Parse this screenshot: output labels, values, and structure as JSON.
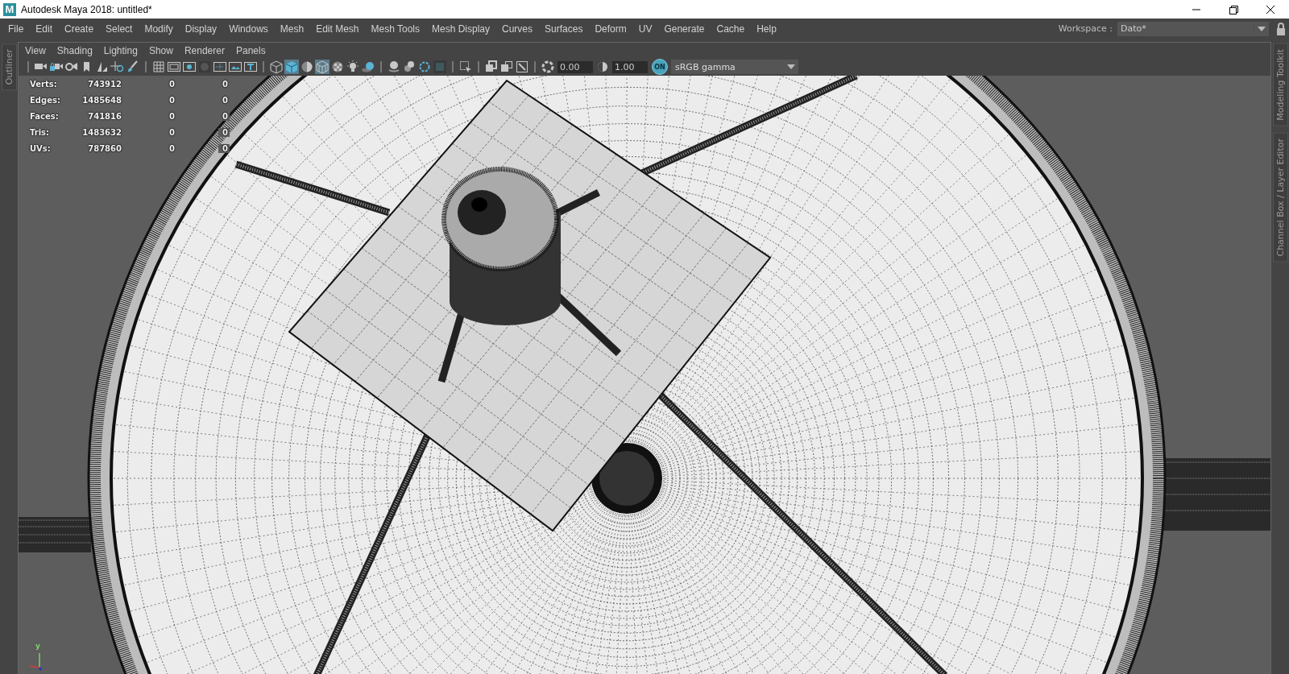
{
  "window": {
    "app_logo": "M",
    "title": "Autodesk Maya 2018: untitled*"
  },
  "menubar": [
    "File",
    "Edit",
    "Create",
    "Select",
    "Modify",
    "Display",
    "Windows",
    "Mesh",
    "Edit Mesh",
    "Mesh Tools",
    "Mesh Display",
    "Curves",
    "Surfaces",
    "Deform",
    "UV",
    "Generate",
    "Cache",
    "Help"
  ],
  "workspace": {
    "label": "Workspace :",
    "value": "Dato*",
    "locked": true
  },
  "left_tabs": [
    "Outliner"
  ],
  "right_tabs": [
    "Modeling Toolkit",
    "Channel Box / Layer Editor"
  ],
  "panel_menu": [
    "View",
    "Shading",
    "Lighting",
    "Show",
    "Renderer",
    "Panels"
  ],
  "toolbar": [
    {
      "kind": "separator"
    },
    {
      "kind": "icon",
      "selected": false
    },
    {
      "kind": "icon",
      "selected": false
    },
    {
      "kind": "icon",
      "selected": false
    },
    {
      "kind": "icon",
      "selected": false
    },
    {
      "kind": "icon",
      "selected": false
    },
    {
      "kind": "icon",
      "selected": false
    },
    {
      "kind": "icon",
      "selected": false
    },
    {
      "kind": "separator"
    },
    {
      "kind": "icon",
      "selected": false
    },
    {
      "kind": "icon",
      "selected": false
    },
    {
      "kind": "icon",
      "selected": false
    },
    {
      "kind": "icon",
      "selected": false
    },
    {
      "kind": "icon",
      "selected": false
    },
    {
      "kind": "icon",
      "selected": false
    },
    {
      "kind": "icon",
      "selected": false
    },
    {
      "kind": "separator"
    },
    {
      "kind": "icon",
      "selected": false
    },
    {
      "kind": "icon",
      "selected": true
    },
    {
      "kind": "icon",
      "selected": false
    },
    {
      "kind": "icon",
      "selected": true
    },
    {
      "kind": "icon",
      "selected": false
    },
    {
      "kind": "icon",
      "selected": false
    },
    {
      "kind": "icon",
      "selected": false
    },
    {
      "kind": "separator"
    },
    {
      "kind": "icon",
      "selected": false
    },
    {
      "kind": "icon",
      "selected": false
    },
    {
      "kind": "icon",
      "selected": false
    },
    {
      "kind": "icon",
      "selected": false
    },
    {
      "kind": "separator"
    },
    {
      "kind": "icon",
      "selected": false
    },
    {
      "kind": "separator"
    },
    {
      "kind": "icon",
      "selected": false
    },
    {
      "kind": "icon",
      "selected": false
    },
    {
      "kind": "icon",
      "selected": false
    },
    {
      "kind": "separator"
    },
    {
      "kind": "icon",
      "selected": false
    },
    {
      "kind": "field",
      "value": "0.00"
    },
    {
      "kind": "icon",
      "selected": false
    },
    {
      "kind": "field",
      "value": "1.00"
    },
    {
      "kind": "toggle",
      "label": "ON",
      "on": true
    },
    {
      "kind": "dropdown",
      "value": "sRGB gamma"
    }
  ],
  "stats": [
    {
      "label": "Verts:",
      "values": [
        "743912",
        "0",
        "0"
      ]
    },
    {
      "label": "Edges:",
      "values": [
        "1485648",
        "0",
        "0"
      ]
    },
    {
      "label": "Faces:",
      "values": [
        "741816",
        "0",
        "0"
      ]
    },
    {
      "label": "Tris:",
      "values": [
        "1483632",
        "0",
        "0"
      ]
    },
    {
      "label": "UVs:",
      "values": [
        "787860",
        "0",
        "0"
      ]
    }
  ],
  "axis_gizmo": {
    "y_label": "y"
  }
}
